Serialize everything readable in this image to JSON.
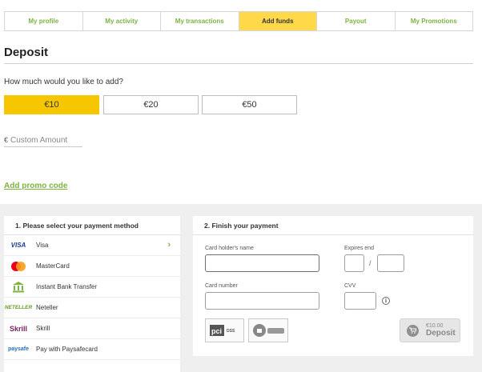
{
  "tabs": [
    {
      "label": "My profile",
      "active": false
    },
    {
      "label": "My activity",
      "active": false
    },
    {
      "label": "My transactions",
      "active": false
    },
    {
      "label": "Add funds",
      "active": true
    },
    {
      "label": "Payout",
      "active": false
    },
    {
      "label": "My Promotions",
      "active": false
    }
  ],
  "page_title": "Deposit",
  "question": "How much would you like to add?",
  "amounts": [
    "€10",
    "€20",
    "€50"
  ],
  "selected_amount": "€10",
  "custom_amount": {
    "currency": "€",
    "placeholder": "Custom Amount"
  },
  "promo_link": "Add promo code",
  "payment_methods": {
    "heading": "1. Please select your payment method",
    "items": [
      {
        "label": "Visa",
        "icon": "visa-icon",
        "selected": true
      },
      {
        "label": "MasterCard",
        "icon": "mastercard-icon"
      },
      {
        "label": "Instant Bank Transfer",
        "icon": "bank-icon"
      },
      {
        "label": "Neteller",
        "icon": "neteller-icon"
      },
      {
        "label": "Skrill",
        "icon": "skrill-icon"
      },
      {
        "label": "Pay with Paysafecard",
        "icon": "paysafecard-icon"
      }
    ],
    "logo_text": {
      "visa": "VISA",
      "neteller": "NETELLER",
      "skrill": "Skrill",
      "paysafe": "paysafe"
    }
  },
  "finish": {
    "heading": "2. Finish your payment",
    "card_holder_label": "Card holder's name",
    "expires_label": "Expires end",
    "card_number_label": "Card number",
    "cvv_label": "CVV",
    "expiry_separator": "/",
    "info_glyph": "i",
    "badges": [
      "PCI DSS",
      "Comodo Secure"
    ],
    "deposit_button": {
      "amount": "€10.00",
      "label": "Deposit"
    }
  },
  "colors": {
    "accent_yellow": "#f6c700",
    "tab_active": "#ffd94a",
    "green": "#7cb342",
    "bg_gray": "#efefef"
  }
}
